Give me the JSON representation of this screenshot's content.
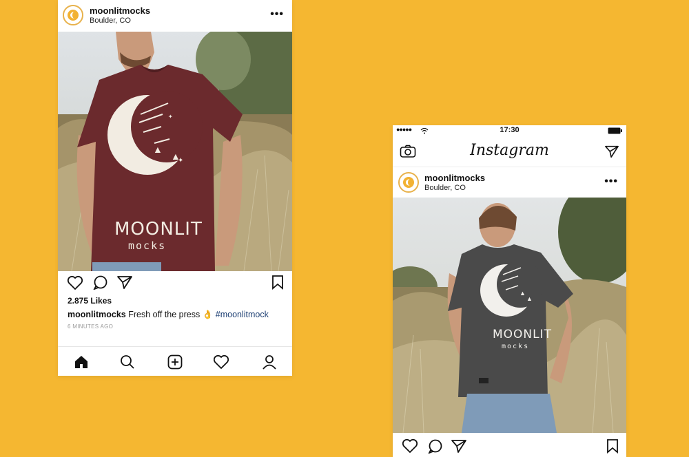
{
  "left_post": {
    "username": "moonlitmocks",
    "location": "Boulder, CO",
    "more_icon": "•••",
    "shirt_brand_line1": "MOONLIT",
    "shirt_brand_line2": "mocks",
    "likes": "2.875 Likes",
    "caption_user": "moonlitmocks",
    "caption_text": "Fresh off the press 👌",
    "caption_tag": "#moonlitmock",
    "time": "6 MINUTES AGO"
  },
  "right_post": {
    "status_time": "17:30",
    "app_title": "Instagram",
    "username": "moonlitmocks",
    "location": "Boulder, CO",
    "more_icon": "•••",
    "shirt_brand_line1": "MOONLIT",
    "shirt_brand_line2": "mocks"
  },
  "colors": {
    "background": "#F5B731",
    "left_shirt": "#6B2A2D",
    "right_shirt": "#4A4A4A",
    "hashtag": "#1D3F73"
  },
  "icons": [
    "heart-icon",
    "comment-icon",
    "send-icon",
    "bookmark-icon",
    "home-icon",
    "search-icon",
    "add-icon",
    "activity-icon",
    "profile-icon",
    "camera-icon",
    "direct-icon",
    "wifi-icon",
    "battery-icon"
  ]
}
